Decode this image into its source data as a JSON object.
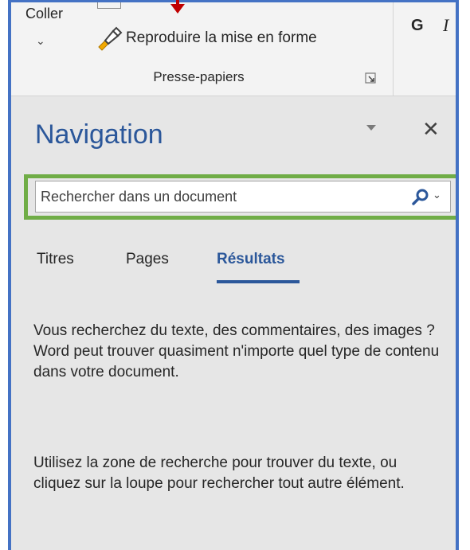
{
  "ribbon": {
    "paste_label": "Coller",
    "format_painter_label": "Reproduire la mise en forme",
    "group_label": "Presse-papiers",
    "bold_label": "G",
    "italic_label": "I"
  },
  "pane": {
    "title": "Navigation",
    "search": {
      "placeholder": "Rechercher dans un document",
      "value": ""
    },
    "tabs": [
      {
        "label": "Titres",
        "active": false
      },
      {
        "label": "Pages",
        "active": false
      },
      {
        "label": "Résultats",
        "active": true
      }
    ],
    "message_1": "Vous recherchez du texte, des commentaires, des images ? Word peut trouver quasiment n'importe quel type de contenu dans votre document.",
    "message_2": "Utilisez la zone de recherche pour trouver du texte, ou cliquez sur la loupe pour rechercher tout autre élément."
  },
  "colors": {
    "accent_blue": "#2b579a",
    "frame_blue": "#4472c4",
    "highlight_green": "#70ad47",
    "arrow_red": "#c00000",
    "pane_bg": "#e6e6e6"
  },
  "icons": [
    "chevron-down-icon",
    "format-painter-icon",
    "dialog-launcher-icon",
    "pane-options-icon",
    "close-icon",
    "search-icon",
    "arrow-indicator-icon"
  ]
}
